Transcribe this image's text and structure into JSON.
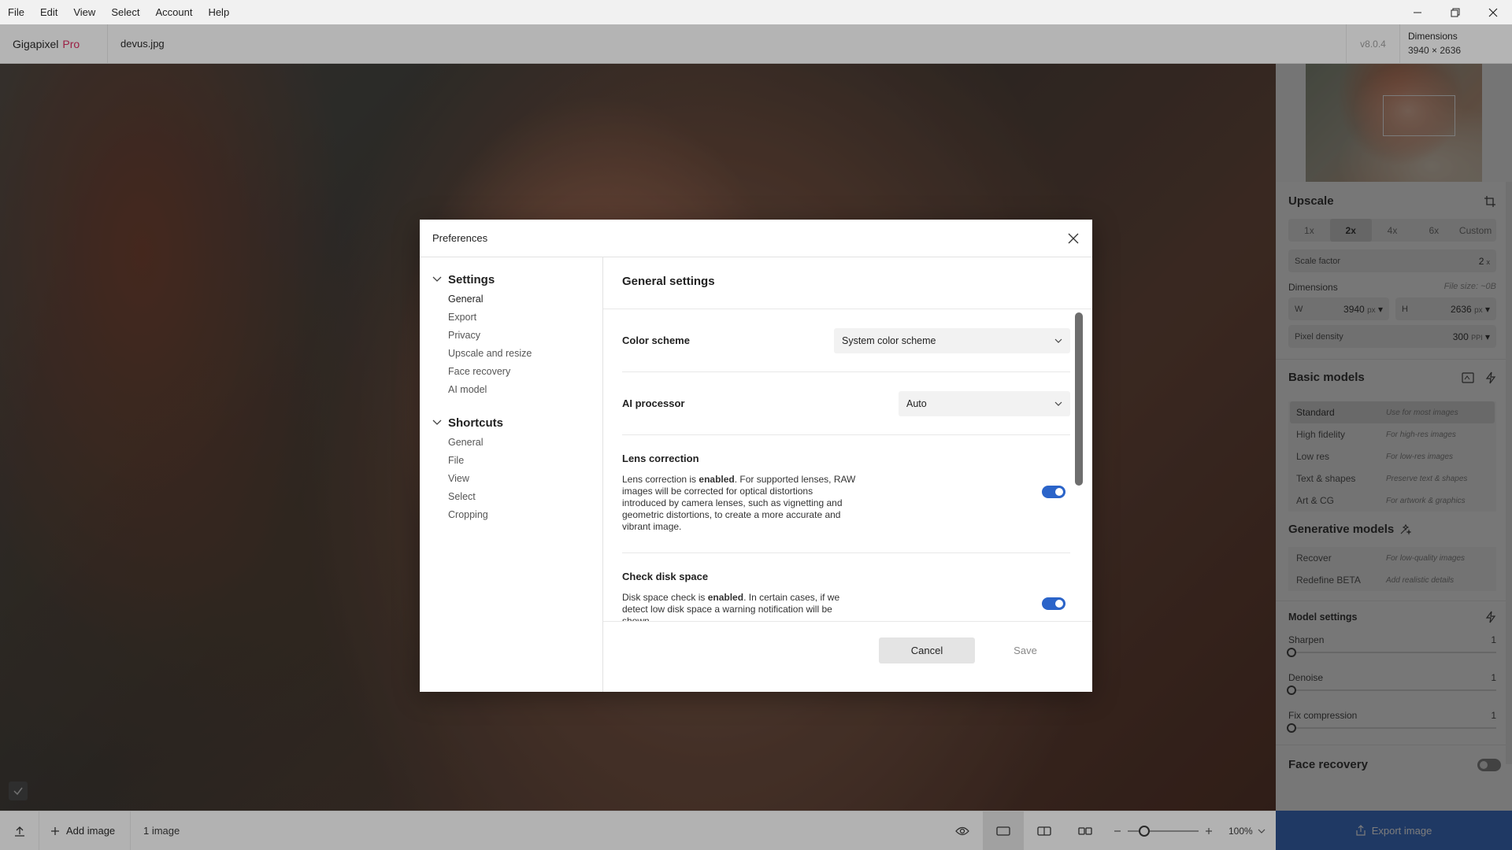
{
  "menubar": {
    "items": [
      "File",
      "Edit",
      "View",
      "Select",
      "Account",
      "Help"
    ]
  },
  "appbar": {
    "brand": "Gigapixel",
    "brand_suffix": "Pro",
    "filename": "devus.jpg",
    "version": "v8.0.4",
    "dims_label": "Dimensions",
    "dims_value": "3940 × 2636"
  },
  "bottombar": {
    "add_label": "Add image",
    "count": "1 image",
    "zoom": "100%"
  },
  "rpanel": {
    "upscale_title": "Upscale",
    "scale_options": [
      "1x",
      "2x",
      "4x",
      "6x",
      "Custom"
    ],
    "scale_factor_label": "Scale factor",
    "scale_factor_value": "2",
    "scale_factor_unit": "x",
    "dimensions_label": "Dimensions",
    "file_size": "File size: ~0B",
    "w_label": "W",
    "w_value": "3940",
    "w_unit": "px",
    "h_label": "H",
    "h_value": "2636",
    "h_unit": "px",
    "density_label": "Pixel density",
    "density_value": "300",
    "density_unit": "PPI",
    "basic_title": "Basic models",
    "basic_models": [
      {
        "name": "Standard",
        "desc": "Use for most images"
      },
      {
        "name": "High fidelity",
        "desc": "For high-res images"
      },
      {
        "name": "Low res",
        "desc": "For low-res images"
      },
      {
        "name": "Text & shapes",
        "desc": "Preserve text & shapes"
      },
      {
        "name": "Art & CG",
        "desc": "For artwork & graphics"
      }
    ],
    "gen_title": "Generative models",
    "gen_models": [
      {
        "name": "Recover",
        "desc": "For low-quality images"
      },
      {
        "name": "Redefine BETA",
        "desc": "Add realistic details"
      }
    ],
    "model_settings_title": "Model settings",
    "sliders": [
      {
        "label": "Sharpen",
        "value": "1"
      },
      {
        "label": "Denoise",
        "value": "1"
      },
      {
        "label": "Fix compression",
        "value": "1"
      }
    ],
    "face_recovery": "Face recovery",
    "export_label": "Export image"
  },
  "dialog": {
    "title": "Preferences",
    "settings_head": "Settings",
    "settings_items": [
      "General",
      "Export",
      "Privacy",
      "Upscale and resize",
      "Face recovery",
      "AI model"
    ],
    "shortcuts_head": "Shortcuts",
    "shortcuts_items": [
      "General",
      "File",
      "View",
      "Select",
      "Cropping"
    ],
    "main_title": "General settings",
    "color_scheme_label": "Color scheme",
    "color_scheme_value": "System color scheme",
    "ai_processor_label": "AI processor",
    "ai_processor_value": "Auto",
    "lens_title": "Lens correction",
    "lens_desc_pre": "Lens correction is ",
    "lens_desc_bold": "enabled",
    "lens_desc_post": ". For supported lenses, RAW images will be corrected for optical distortions introduced by camera lenses, such as vignetting and geometric distortions, to create a more accurate and vibrant image.",
    "disk_title": "Check disk space",
    "disk_desc_pre": "Disk space check is ",
    "disk_desc_bold": "enabled",
    "disk_desc_post": ". In certain cases, if we detect low disk space a warning notification will be shown.",
    "cancel_label": "Cancel",
    "save_label": "Save"
  },
  "colors": {
    "accent": "#2b64c9",
    "brand_pro": "#d6245a"
  }
}
